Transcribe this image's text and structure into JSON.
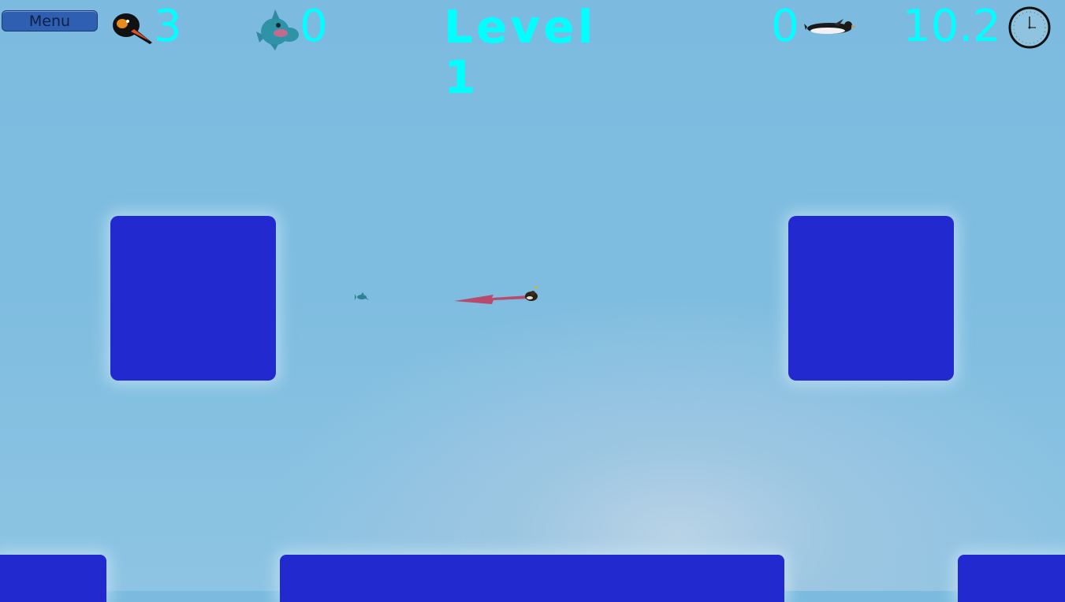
{
  "hud": {
    "menu_label": "Menu",
    "lives_icon": "penguin-head-icon",
    "lives_count": "3",
    "fish_icon": "blue-fish-icon",
    "fish_count": "0",
    "level_title": "Level 1",
    "penguins_count": "0",
    "penguins_icon": "swimming-penguin-icon",
    "timer_value": "10.2",
    "timer_icon": "clock-icon"
  },
  "colors": {
    "hud_text": "#00ffff",
    "block": "#2129cf",
    "water": "#7cbbdf",
    "menu_button": "#2f5fb0"
  }
}
